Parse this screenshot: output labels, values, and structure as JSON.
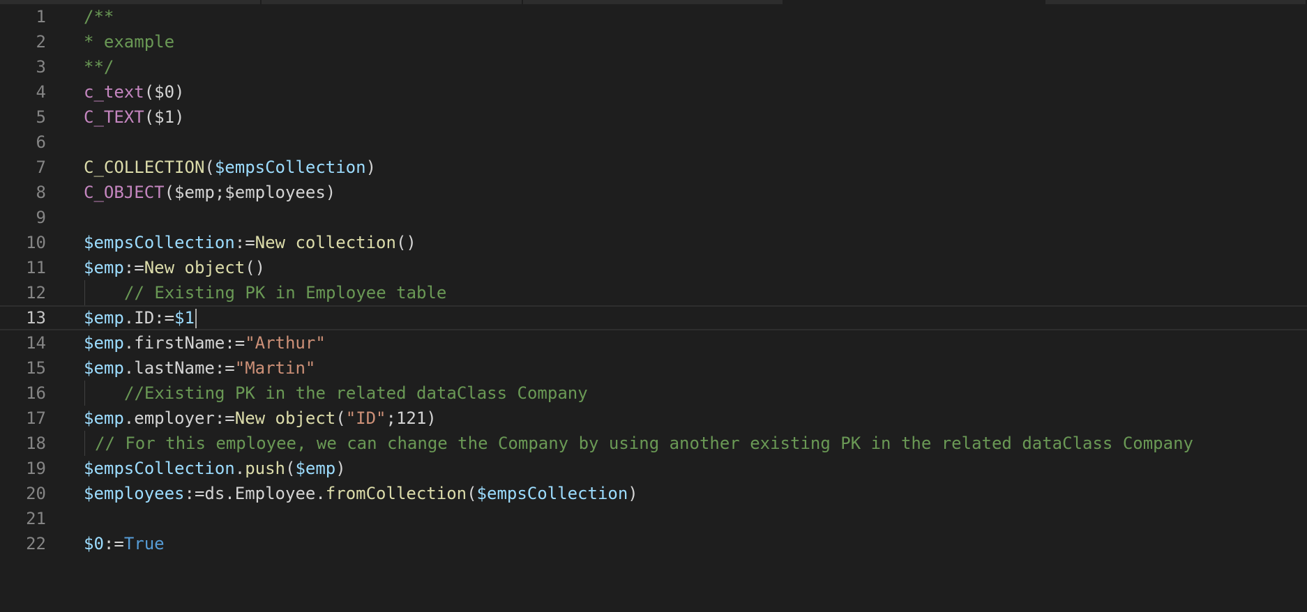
{
  "editor": {
    "theme_colors": {
      "background": "#1e1e1e",
      "comment": "#6a9955",
      "command": "#c586c0",
      "function": "#dcdcaa",
      "variable": "#9cdcfe",
      "string": "#ce9178",
      "constant": "#569cd6",
      "plain": "#d4d4d4",
      "line_number": "#858585"
    },
    "current_line": 13,
    "lines": [
      {
        "n": "1",
        "tokens": [
          {
            "t": "/**",
            "c": "comment"
          }
        ]
      },
      {
        "n": "2",
        "tokens": [
          {
            "t": "* example",
            "c": "comment"
          }
        ]
      },
      {
        "n": "3",
        "tokens": [
          {
            "t": "**/",
            "c": "comment"
          }
        ]
      },
      {
        "n": "4",
        "tokens": [
          {
            "t": "c_text",
            "c": "cmd"
          },
          {
            "t": "($0)",
            "c": "plain"
          }
        ]
      },
      {
        "n": "5",
        "tokens": [
          {
            "t": "C_TEXT",
            "c": "cmd"
          },
          {
            "t": "($1)",
            "c": "plain"
          }
        ]
      },
      {
        "n": "6",
        "tokens": []
      },
      {
        "n": "7",
        "tokens": [
          {
            "t": "C_COLLECTION",
            "c": "fn"
          },
          {
            "t": "(",
            "c": "plain"
          },
          {
            "t": "$empsCollection",
            "c": "var"
          },
          {
            "t": ")",
            "c": "plain"
          }
        ]
      },
      {
        "n": "8",
        "tokens": [
          {
            "t": "C_OBJECT",
            "c": "cmd"
          },
          {
            "t": "($emp;$employees)",
            "c": "plain"
          }
        ]
      },
      {
        "n": "9",
        "tokens": []
      },
      {
        "n": "10",
        "tokens": [
          {
            "t": "$empsCollection",
            "c": "var"
          },
          {
            "t": ":=",
            "c": "plain"
          },
          {
            "t": "New collection",
            "c": "fn"
          },
          {
            "t": "()",
            "c": "plain"
          }
        ]
      },
      {
        "n": "11",
        "tokens": [
          {
            "t": "$emp",
            "c": "var"
          },
          {
            "t": ":=",
            "c": "plain"
          },
          {
            "t": "New object",
            "c": "fn"
          },
          {
            "t": "()",
            "c": "plain"
          }
        ]
      },
      {
        "n": "12",
        "guide": true,
        "indent": "deep",
        "tokens": [
          {
            "t": "// Existing PK in Employee table",
            "c": "comment"
          }
        ]
      },
      {
        "n": "13",
        "current": true,
        "cursor": true,
        "tokens": [
          {
            "t": "$emp",
            "c": "var"
          },
          {
            "t": ".ID:=",
            "c": "plain"
          },
          {
            "t": "$1",
            "c": "var"
          }
        ]
      },
      {
        "n": "14",
        "tokens": [
          {
            "t": "$emp",
            "c": "var"
          },
          {
            "t": ".firstName:=",
            "c": "plain"
          },
          {
            "t": "\"Arthur\"",
            "c": "str"
          }
        ]
      },
      {
        "n": "15",
        "tokens": [
          {
            "t": "$emp",
            "c": "var"
          },
          {
            "t": ".lastName:=",
            "c": "plain"
          },
          {
            "t": "\"Martin\"",
            "c": "str"
          }
        ]
      },
      {
        "n": "16",
        "guide": true,
        "indent": "deep",
        "tokens": [
          {
            "t": "//Existing PK in the related dataClass Company",
            "c": "comment"
          }
        ]
      },
      {
        "n": "17",
        "tokens": [
          {
            "t": "$emp",
            "c": "var"
          },
          {
            "t": ".employer:=",
            "c": "plain"
          },
          {
            "t": "New object",
            "c": "fn"
          },
          {
            "t": "(",
            "c": "plain"
          },
          {
            "t": "\"ID\"",
            "c": "str"
          },
          {
            "t": ";121)",
            "c": "plain"
          }
        ]
      },
      {
        "n": "18",
        "guide": true,
        "indent": "small",
        "tokens": [
          {
            "t": "// For this employee, we can change the Company by using another existing PK in the related dataClass Company",
            "c": "comment"
          }
        ]
      },
      {
        "n": "19",
        "tokens": [
          {
            "t": "$empsCollection",
            "c": "var"
          },
          {
            "t": ".",
            "c": "plain"
          },
          {
            "t": "push",
            "c": "fn"
          },
          {
            "t": "(",
            "c": "plain"
          },
          {
            "t": "$emp",
            "c": "var"
          },
          {
            "t": ")",
            "c": "plain"
          }
        ]
      },
      {
        "n": "20",
        "tokens": [
          {
            "t": "$employees",
            "c": "var"
          },
          {
            "t": ":=ds.Employee.",
            "c": "plain"
          },
          {
            "t": "fromCollection",
            "c": "fn"
          },
          {
            "t": "(",
            "c": "plain"
          },
          {
            "t": "$empsCollection",
            "c": "var"
          },
          {
            "t": ")",
            "c": "plain"
          }
        ]
      },
      {
        "n": "21",
        "tokens": []
      },
      {
        "n": "22",
        "tokens": [
          {
            "t": "$0",
            "c": "var"
          },
          {
            "t": ":=",
            "c": "plain"
          },
          {
            "t": "True",
            "c": "kw"
          }
        ]
      }
    ]
  }
}
